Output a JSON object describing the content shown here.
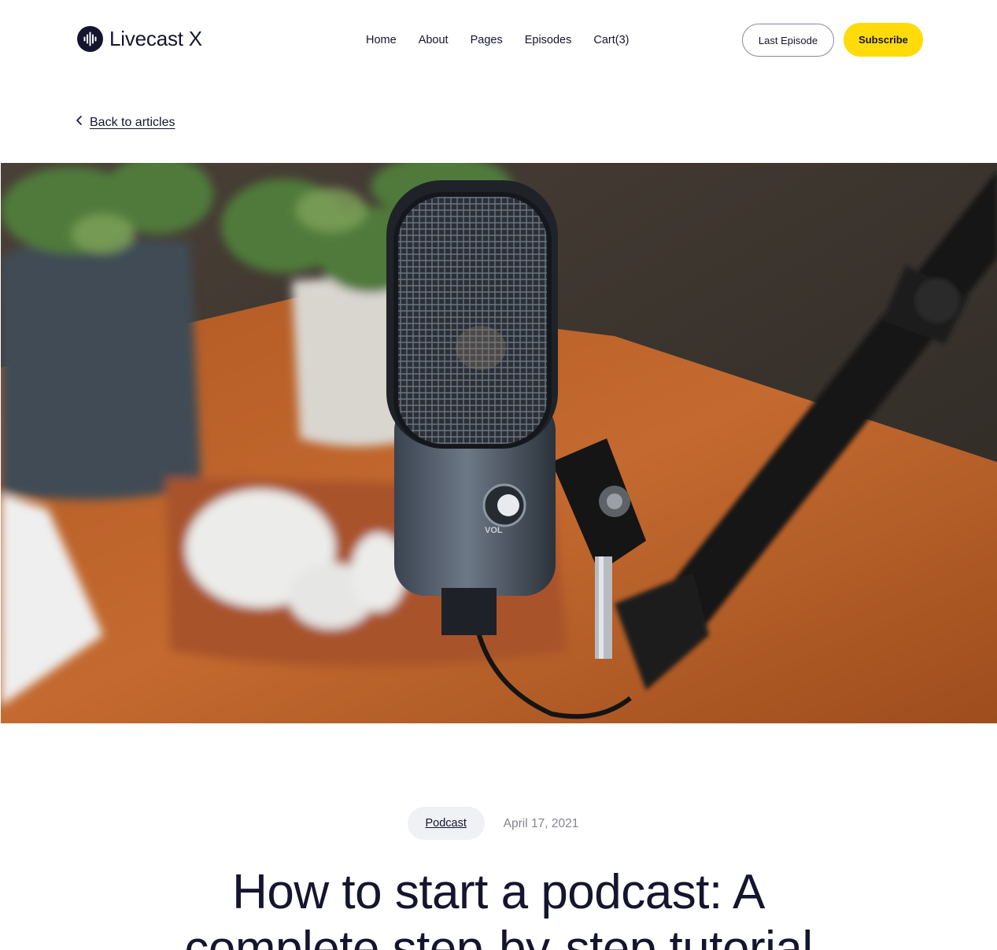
{
  "brand": {
    "name": "Livecast X",
    "logo_icon": "sound-wave-icon"
  },
  "nav": {
    "items": [
      "Home",
      "About",
      "Pages",
      "Episodes",
      "Cart(3)"
    ]
  },
  "actions": {
    "last_episode": "Last Episode",
    "subscribe": "Subscribe"
  },
  "back_link": {
    "label": "Back to articles",
    "icon": "chevron-left-icon"
  },
  "hero": {
    "image_subject": "microphone-on-desk"
  },
  "article": {
    "category": "Podcast",
    "date": "April 17, 2021",
    "title": "How to start a podcast: A complete step-by-step tutorial"
  },
  "colors": {
    "text": "#151530",
    "accent": "#ffdb0a",
    "muted": "#84848f",
    "tag_bg": "#eff1f5"
  }
}
